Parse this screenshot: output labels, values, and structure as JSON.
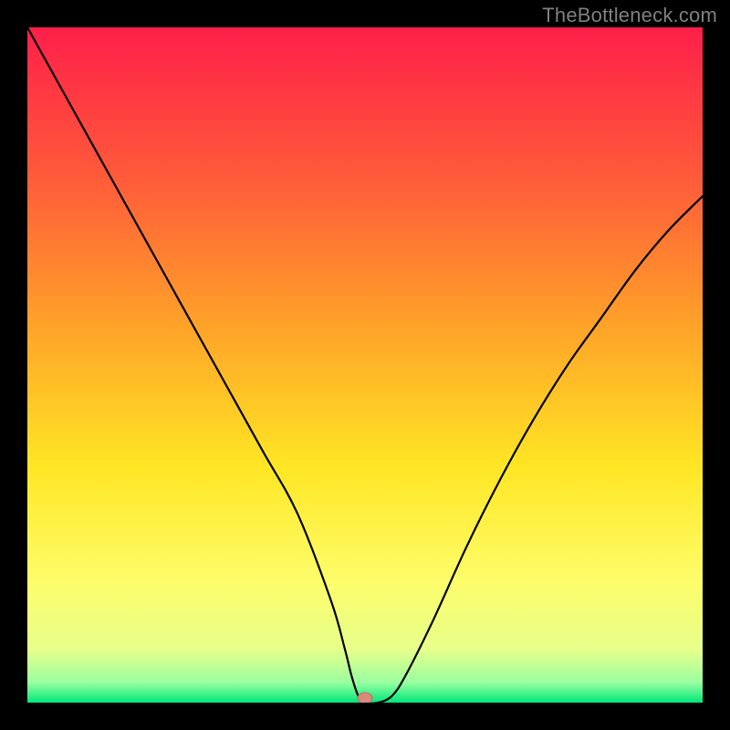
{
  "watermark": "TheBottleneck.com",
  "chart_data": {
    "type": "line",
    "title": "",
    "xlabel": "",
    "ylabel": "",
    "xlim": [
      0,
      100
    ],
    "ylim": [
      0,
      100
    ],
    "grid": false,
    "legend": false,
    "series": [
      {
        "name": "bottleneck-curve",
        "x": [
          0,
          5,
          10,
          15,
          20,
          25,
          30,
          35,
          40,
          45,
          47,
          48,
          49,
          50,
          52,
          54,
          56,
          60,
          65,
          70,
          75,
          80,
          85,
          90,
          95,
          100
        ],
        "y": [
          100,
          91,
          82,
          73,
          64,
          55,
          46,
          37,
          28,
          15,
          8,
          4,
          1,
          0,
          0,
          1,
          4,
          12,
          23,
          33,
          42,
          50,
          57,
          64,
          70,
          75
        ]
      }
    ],
    "marker": {
      "x": 50,
      "y": 0,
      "color": "#d98a7a"
    },
    "background_gradient": {
      "stops": [
        {
          "offset": 0.0,
          "color": "#ff1f4a"
        },
        {
          "offset": 0.22,
          "color": "#ff5a3a"
        },
        {
          "offset": 0.45,
          "color": "#ffa528"
        },
        {
          "offset": 0.65,
          "color": "#ffe624"
        },
        {
          "offset": 0.82,
          "color": "#fdfd6a"
        },
        {
          "offset": 0.92,
          "color": "#e8ff8a"
        },
        {
          "offset": 0.97,
          "color": "#9affa0"
        },
        {
          "offset": 1.0,
          "color": "#00e87a"
        }
      ]
    }
  }
}
